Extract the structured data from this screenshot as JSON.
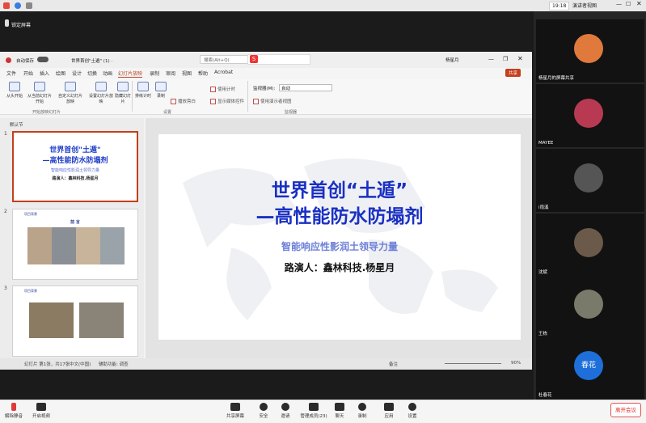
{
  "topbar": {
    "time": "19:18",
    "view_label": "演讲者视图"
  },
  "recording": {
    "label": "锁定屏幕"
  },
  "ppt": {
    "autosave": "自动保存",
    "filename": "世界首创\"土遁\" (1) ·",
    "search": "搜索(Alt+Q)",
    "user": "杨星月",
    "share": "共享",
    "menu": [
      "文件",
      "开始",
      "插入",
      "绘图",
      "设计",
      "切换",
      "动画",
      "幻灯片放映",
      "录制",
      "审阅",
      "视图",
      "帮助",
      "Acrobat"
    ],
    "ribbon": {
      "from_start": "从头开始",
      "from_current": "从当前幻灯片开始",
      "custom": "自定义幻灯片放映",
      "setup": "设置幻灯片放映",
      "hide": "隐藏幻灯片",
      "rehearse": "排练计时",
      "record": "录制",
      "play_narration": "播放旁白",
      "use_timing": "使用计时",
      "show_controls": "显示媒体控件",
      "monitor_label": "监视器(M):",
      "monitor_value": "自动",
      "presenter_view": "使用演示者视图",
      "group1": "开始放映幻灯片",
      "group2": "设置",
      "group3": "监视器"
    },
    "section": "默认节",
    "thumb1": {
      "title1": "世界首创\"土遁\"",
      "title2": "—高性能防水防塌剂",
      "sub": "智能响应性影润土领导力量",
      "author": "路演人：鑫林科技.杨星月"
    },
    "thumb2": {
      "header": "项目背景",
      "title": "前 言"
    },
    "thumb3": {
      "header": "项目背景"
    },
    "slide": {
      "title1": "世界首创“土遁”",
      "title2": "—高性能防水防塌剂",
      "subtitle": "智能响应性影润土领导力量",
      "author": "路演人：鑫林科技.杨星月"
    },
    "status": {
      "slide": "幻灯片 第1张，共17张",
      "lang": "中文(中国)",
      "access": "辅助功能: 调查",
      "notes": "备注",
      "zoom": "90%"
    }
  },
  "participants": [
    {
      "name": "杨星月的屏幕共享",
      "color": "#e07a3c"
    },
    {
      "name": "MAYEE",
      "color": "#b83a52"
    },
    {
      "name": "i雨溪",
      "color": "#555"
    },
    {
      "name": "沈斌",
      "color": "#6b5a4a"
    },
    {
      "name": "王栋",
      "color": "#7a7a6a"
    },
    {
      "name": "杜春花",
      "color": "#1e6fd9",
      "initial": "春花"
    }
  ],
  "toolbar": {
    "unmute": "解除静音",
    "video": "开启视频",
    "share": "共享屏幕",
    "security": "安全",
    "apps": "邀请",
    "members": "管理成员(23)",
    "chat": "聊天",
    "record": "录制",
    "apps2": "应用",
    "settings": "设置",
    "leave": "离开会议"
  }
}
